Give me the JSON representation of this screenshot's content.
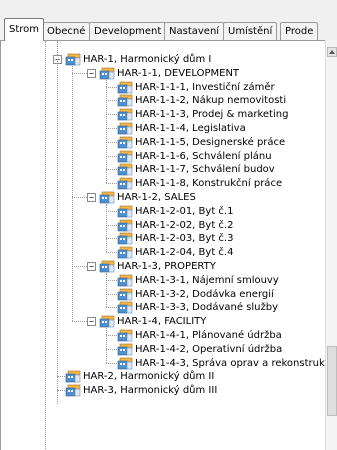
{
  "tabs": [
    {
      "label": "Strom",
      "active": true
    },
    {
      "label": "Obecné",
      "active": false
    },
    {
      "label": "Development",
      "active": false
    },
    {
      "label": "Nastavení",
      "active": false
    },
    {
      "label": "Umístění",
      "active": false
    },
    {
      "label": "Prode",
      "active": false
    }
  ],
  "tree": {
    "root": {
      "label": "HAR-1, Harmonický dům I",
      "expanded": true,
      "groups": [
        {
          "label": "HAR-1-1, DEVELOPMENT",
          "expanded": true,
          "items": [
            "HAR-1-1-1, Investiční záměr",
            "HAR-1-1-2, Nákup nemovitosti",
            "HAR-1-1-3, Prodej & marketing",
            "HAR-1-1-4, Legislativa",
            "HAR-1-1-5, Designerské práce",
            "HAR-1-1-6, Schválení plánu",
            "HAR-1-1-7, Schválení budov",
            "HAR-1-1-8, Konstrukční práce"
          ]
        },
        {
          "label": "HAR-1-2, SALES",
          "expanded": true,
          "items": [
            "HAR-1-2-01, Byt č.1",
            "HAR-1-2-02, Byt č.2",
            "HAR-1-2-03, Byt č.3",
            "HAR-1-2-04, Byt č.4"
          ]
        },
        {
          "label": "HAR-1-3, PROPERTY",
          "expanded": true,
          "items": [
            "HAR-1-3-1, Nájemní smlouvy",
            "HAR-1-3-2, Dodávka energií",
            "HAR-1-3-3, Dodávané služby"
          ]
        },
        {
          "label": "HAR-1-4, FACILITY",
          "expanded": true,
          "items": [
            "HAR-1-4-1, Plánované údržba",
            "HAR-1-4-2, Operativní údržba",
            "HAR-1-4-3, Správa oprav a rekonstrukc"
          ]
        }
      ]
    },
    "siblings": [
      "HAR-2, Harmonický dům II",
      "HAR-3, Harmonický dům III"
    ]
  },
  "icons": {
    "expand_collapse": "minus-box-icon",
    "node": "building-icon"
  },
  "colors": {
    "icon_top": "#f2b64a",
    "icon_front": "#4e8fcf",
    "panel_bg": "#ffffff"
  }
}
